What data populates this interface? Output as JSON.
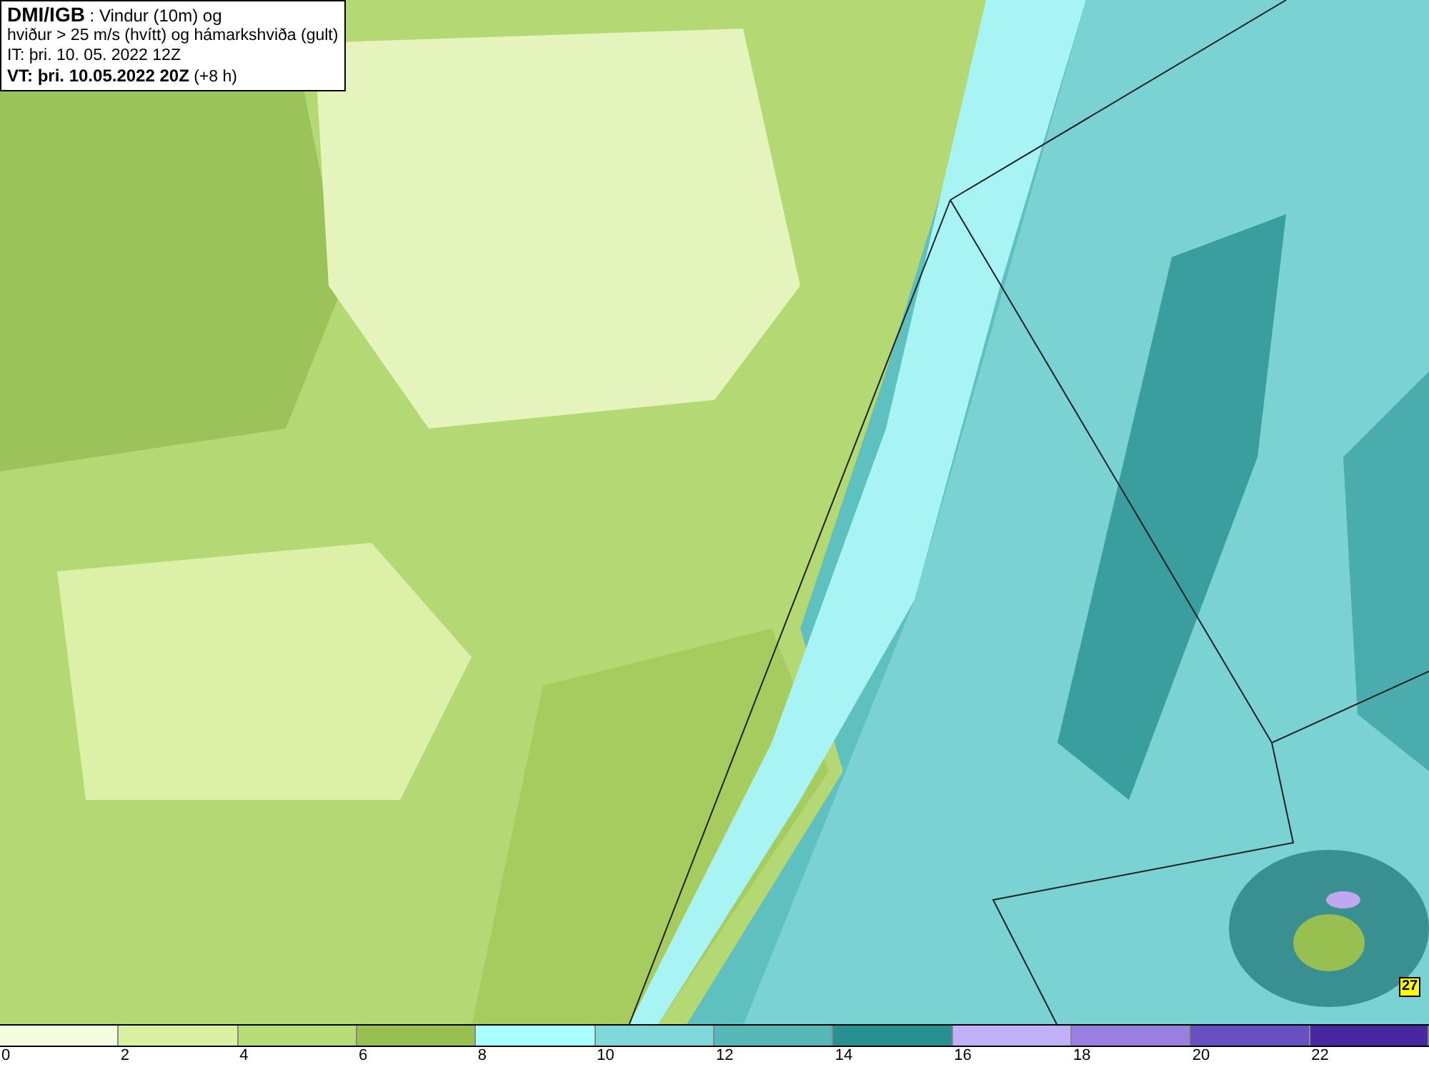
{
  "header": {
    "lines": [
      "**DMI/IGB** : Vindur (10m) og",
      "hviður > 25 m/s (hvítt) og hámarkshviða (gult)",
      "IT: þri. 10. 05. 2022 12Z",
      "**VT: þri. 10.05.2022 20Z** (+8 h)"
    ]
  },
  "map": {
    "max_gust_label": "27"
  },
  "legend": [
    {
      "label": "0",
      "color": "#f5fde0"
    },
    {
      "label": "2",
      "color": "#d8f0a0"
    },
    {
      "label": "4",
      "color": "#b8dc78"
    },
    {
      "label": "6",
      "color": "#98c050"
    },
    {
      "label": "8",
      "color": "#aaffff"
    },
    {
      "label": "10",
      "color": "#80d8d8"
    },
    {
      "label": "12",
      "color": "#58b8b8"
    },
    {
      "label": "14",
      "color": "#289090"
    },
    {
      "label": "16",
      "color": "#c0b0f8"
    },
    {
      "label": "18",
      "color": "#9880e0"
    },
    {
      "label": "20",
      "color": "#6850c0"
    },
    {
      "label": "22",
      "color": "#4828a0"
    }
  ]
}
